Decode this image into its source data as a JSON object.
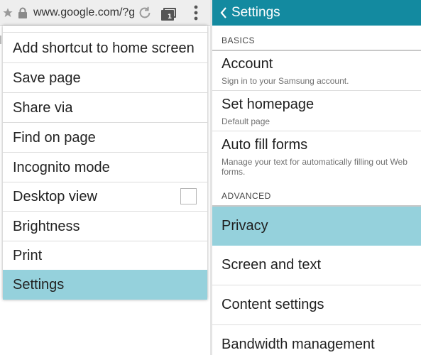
{
  "browser": {
    "url": "www.google.com/?g",
    "tab_count": "1",
    "icons": [
      "star-icon",
      "lock-icon",
      "reload-icon",
      "tabs-icon",
      "more-vertical-icon"
    ]
  },
  "menu": {
    "items": [
      {
        "label": "Add shortcut to home screen"
      },
      {
        "label": "Save page"
      },
      {
        "label": "Share via"
      },
      {
        "label": "Find on page"
      },
      {
        "label": "Incognito mode"
      },
      {
        "label": "Desktop view",
        "checkbox": false
      },
      {
        "label": "Brightness"
      },
      {
        "label": "Print"
      },
      {
        "label": "Settings",
        "selected": true
      }
    ]
  },
  "settings": {
    "title": "Settings",
    "basics_header": "BASICS",
    "advanced_header": "ADVANCED",
    "items": [
      {
        "title": "Account",
        "subtitle": "Sign in to your Samsung account."
      },
      {
        "title": "Set homepage",
        "subtitle": "Default page"
      },
      {
        "title": "Auto fill forms",
        "subtitle": "Manage your text for automatically filling out Web forms."
      },
      {
        "title": "Privacy",
        "selected": true
      },
      {
        "title": "Screen and text"
      },
      {
        "title": "Content settings"
      },
      {
        "title": "Bandwidth management"
      }
    ]
  },
  "colors": {
    "header_bg": "#138aa0",
    "selected_bg": "#95d1dc",
    "urlbar_bg": "#eeeeee"
  }
}
